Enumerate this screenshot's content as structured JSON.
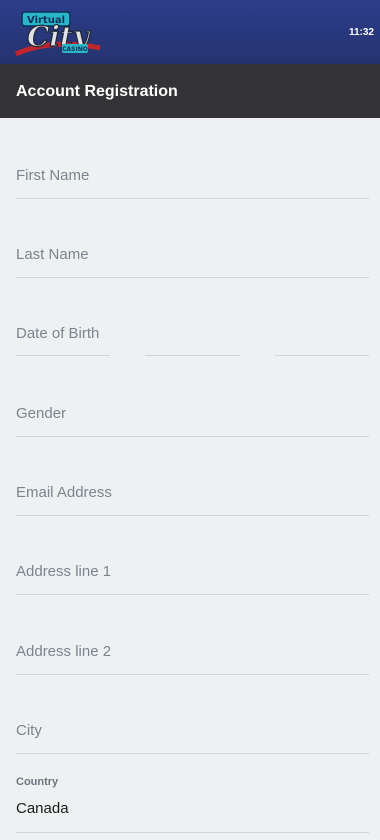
{
  "header": {
    "logo": {
      "word1": "Virtual",
      "word2": "City",
      "word3": "CASINO"
    },
    "time": "11:32"
  },
  "page": {
    "title": "Account Registration"
  },
  "form": {
    "first_name": {
      "placeholder": "First Name"
    },
    "last_name": {
      "placeholder": "Last Name"
    },
    "dob": {
      "placeholder": "Date of Birth"
    },
    "gender": {
      "placeholder": "Gender"
    },
    "email": {
      "placeholder": "Email Address"
    },
    "address1": {
      "placeholder": "Address line 1"
    },
    "address2": {
      "placeholder": "Address line 2"
    },
    "city": {
      "placeholder": "City"
    },
    "country": {
      "label": "Country",
      "value": "Canada"
    }
  },
  "colors": {
    "header_bg": "#2d3d8a",
    "titlebar_bg": "#333335",
    "page_bg": "#eef1f2",
    "placeholder": "#7a858d",
    "underline": "#cfd4d7"
  }
}
